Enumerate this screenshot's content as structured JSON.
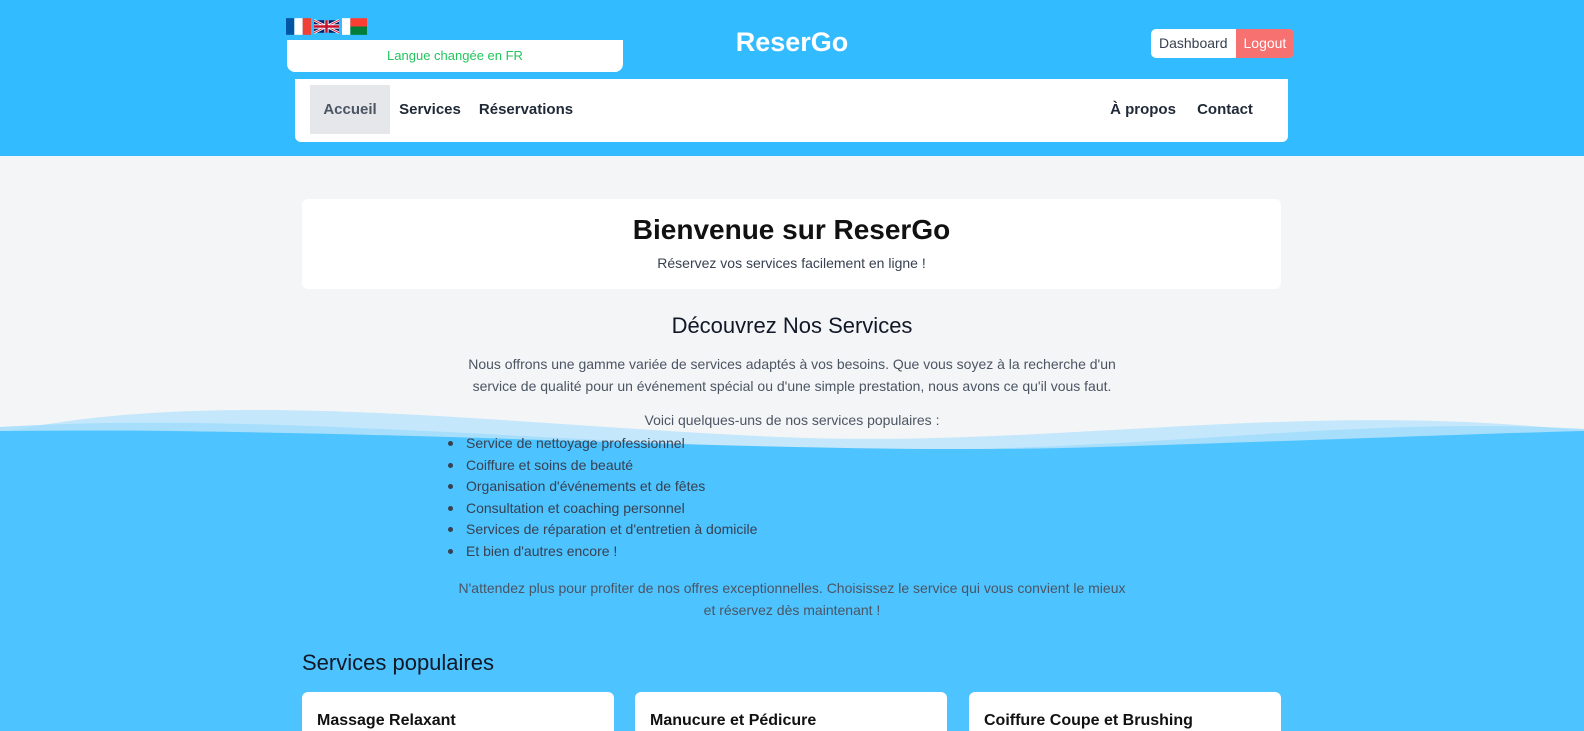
{
  "header": {
    "brand": "ReserGo",
    "language_message": "Langue changée en FR",
    "flags": [
      "french-flag",
      "uk-flag",
      "madagascar-flag"
    ],
    "dashboard_label": "Dashboard",
    "logout_label": "Logout"
  },
  "nav": {
    "left": [
      {
        "label": "Accueil",
        "active": true
      },
      {
        "label": "Services"
      },
      {
        "label": "Réservations"
      }
    ],
    "right": [
      {
        "label": "À propos"
      },
      {
        "label": "Contact"
      }
    ]
  },
  "hero": {
    "title": "Bienvenue sur ReserGo",
    "subtitle": "Réservez vos services facilement en ligne !"
  },
  "discover": {
    "title": "Découvrez Nos Services",
    "intro_line1": "Nous offrons une gamme variée de services adaptés à vos besoins. Que vous soyez à la recherche d'un",
    "intro_line2": "service de qualité pour un événement spécial ou d'une simple prestation, nous avons ce qu'il vous faut.",
    "list_intro": "Voici quelques-uns de nos services populaires :",
    "items": [
      "Service de nettoyage professionnel",
      "Coiffure et soins de beauté",
      "Organisation d'événements et de fêtes",
      "Consultation et coaching personnel",
      "Services de réparation et d'entretien à domicile",
      "Et bien d'autres encore !"
    ],
    "outro_line1": "N'attendez plus pour profiter de nos offres exceptionnelles. Choisissez le service qui vous convient le mieux",
    "outro_line2": "et réservez dès maintenant !"
  },
  "popular": {
    "title": "Services populaires",
    "cards": [
      "Massage Relaxant",
      "Manucure et Pédicure",
      "Coiffure Coupe et Brushing"
    ]
  },
  "colors": {
    "header_blue": "#33bbff",
    "wave_blue": "#4dc3ff",
    "logout_red": "#f87171",
    "message_green": "#22c55e"
  }
}
